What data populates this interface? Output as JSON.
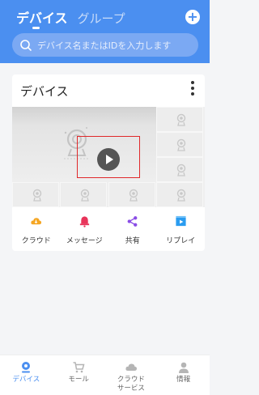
{
  "header": {
    "tabs": [
      {
        "label": "デバイス",
        "active": true
      },
      {
        "label": "グループ",
        "active": false
      }
    ],
    "add_icon": "plus-circle-icon",
    "search": {
      "placeholder": "デバイス名またはIDを入力します"
    }
  },
  "device_card": {
    "title": "デバイス",
    "menu_icon": "more-vertical-icon",
    "actions": [
      {
        "label": "クラウド",
        "icon": "cloud-icon",
        "color": "#f5a623"
      },
      {
        "label": "メッセージ",
        "icon": "bell-icon",
        "color": "#e8345a"
      },
      {
        "label": "共有",
        "icon": "share-icon",
        "color": "#8a4de6"
      },
      {
        "label": "リプレイ",
        "icon": "replay-icon",
        "color": "#2a9cf0"
      }
    ]
  },
  "bottom_nav": {
    "items": [
      {
        "label": "デバイス",
        "icon": "camera-icon",
        "active": true
      },
      {
        "label": "モール",
        "icon": "cart-icon",
        "active": false
      },
      {
        "label": "クラウドサービス",
        "icon": "cloud-service-icon",
        "active": false
      },
      {
        "label": "情報",
        "icon": "person-icon",
        "active": false
      }
    ]
  },
  "colors": {
    "accent": "#4b8ff0",
    "highlight": "#e0282a"
  }
}
